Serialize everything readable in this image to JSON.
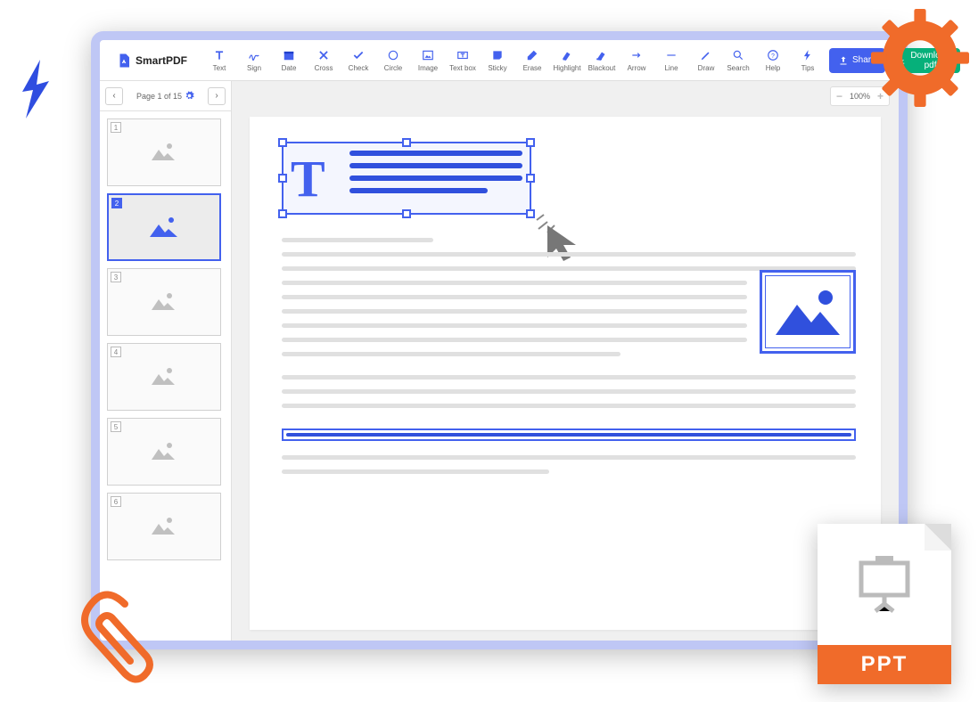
{
  "brand": "SmartPDF",
  "tools": [
    {
      "id": "text",
      "label": "Text"
    },
    {
      "id": "sign",
      "label": "Sign"
    },
    {
      "id": "date",
      "label": "Date"
    },
    {
      "id": "cross",
      "label": "Cross"
    },
    {
      "id": "check",
      "label": "Check"
    },
    {
      "id": "circle",
      "label": "Circle"
    },
    {
      "id": "image",
      "label": "Image"
    },
    {
      "id": "textbox",
      "label": "Text box"
    },
    {
      "id": "sticky",
      "label": "Sticky"
    },
    {
      "id": "erase",
      "label": "Erase"
    },
    {
      "id": "highlight",
      "label": "Highlight"
    },
    {
      "id": "blackout",
      "label": "Blackout"
    },
    {
      "id": "arrow",
      "label": "Arrow"
    },
    {
      "id": "line",
      "label": "Line"
    },
    {
      "id": "draw",
      "label": "Draw"
    }
  ],
  "right_tools": [
    {
      "id": "search",
      "label": "Search"
    },
    {
      "id": "help",
      "label": "Help"
    },
    {
      "id": "tips",
      "label": "Tips"
    }
  ],
  "share_label": "Share",
  "download_label": "Download pdf",
  "page_label": "Page 1 of 15",
  "zoom": "100%",
  "thumbs": [
    "1",
    "2",
    "3",
    "4",
    "5",
    "6"
  ],
  "active_thumb": 2,
  "ppt_label": "PPT"
}
